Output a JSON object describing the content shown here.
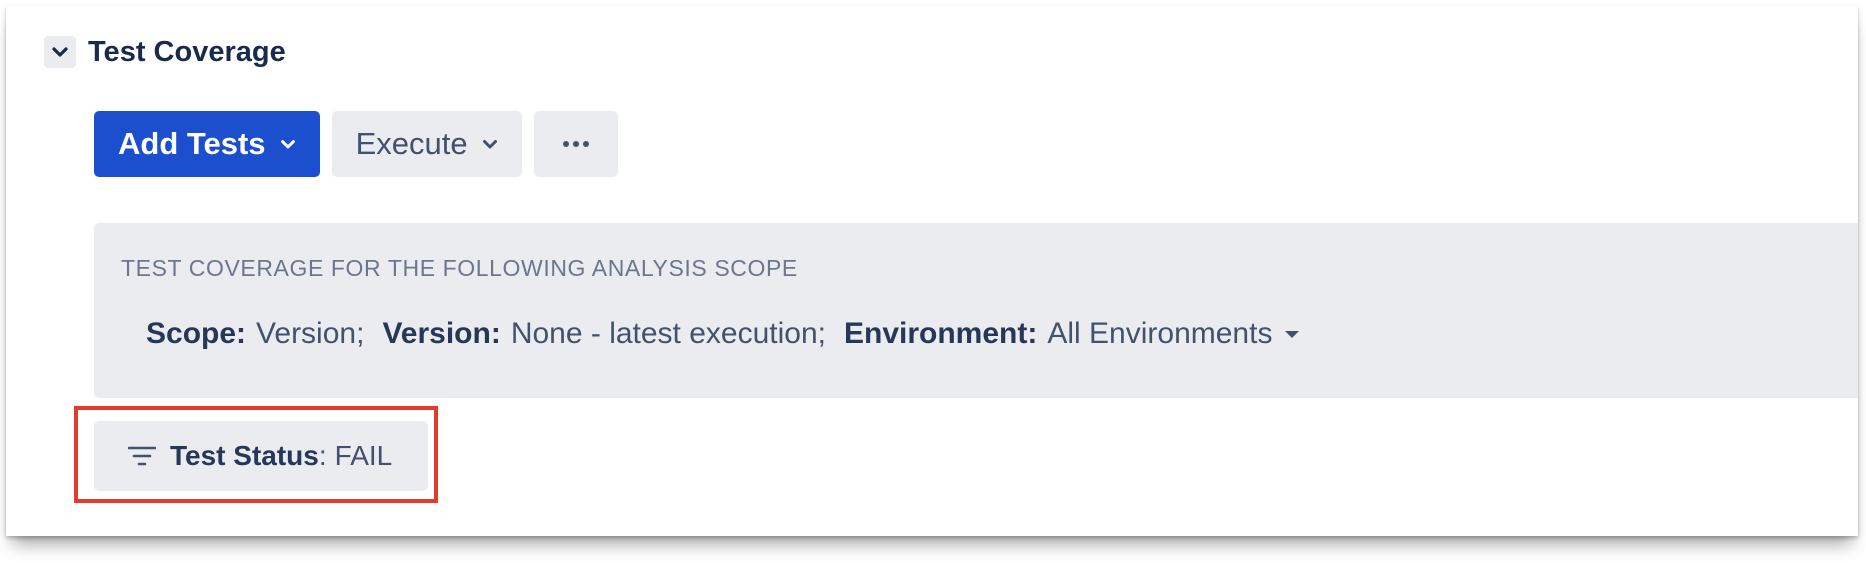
{
  "section": {
    "title": "Test Coverage",
    "toggle_icon": "chevron-down-icon"
  },
  "toolbar": {
    "add_tests_label": "Add Tests",
    "execute_label": "Execute",
    "more_icon": "ellipsis-icon"
  },
  "scope": {
    "heading": "TEST COVERAGE FOR THE FOLLOWING ANALYSIS SCOPE",
    "scope_label": "Scope:",
    "scope_value": "Version;",
    "version_label": "Version:",
    "version_value": "None - latest execution;",
    "environment_label": "Environment:",
    "environment_value": "All Environments"
  },
  "filter": {
    "icon": "filter-icon",
    "label": "Test Status",
    "separator": ":",
    "value": "FAIL"
  },
  "colors": {
    "primary": "#1c4fce",
    "panel_bg": "#ebecf0",
    "highlight": "#e23a2e",
    "text_dark": "#172b4d"
  }
}
